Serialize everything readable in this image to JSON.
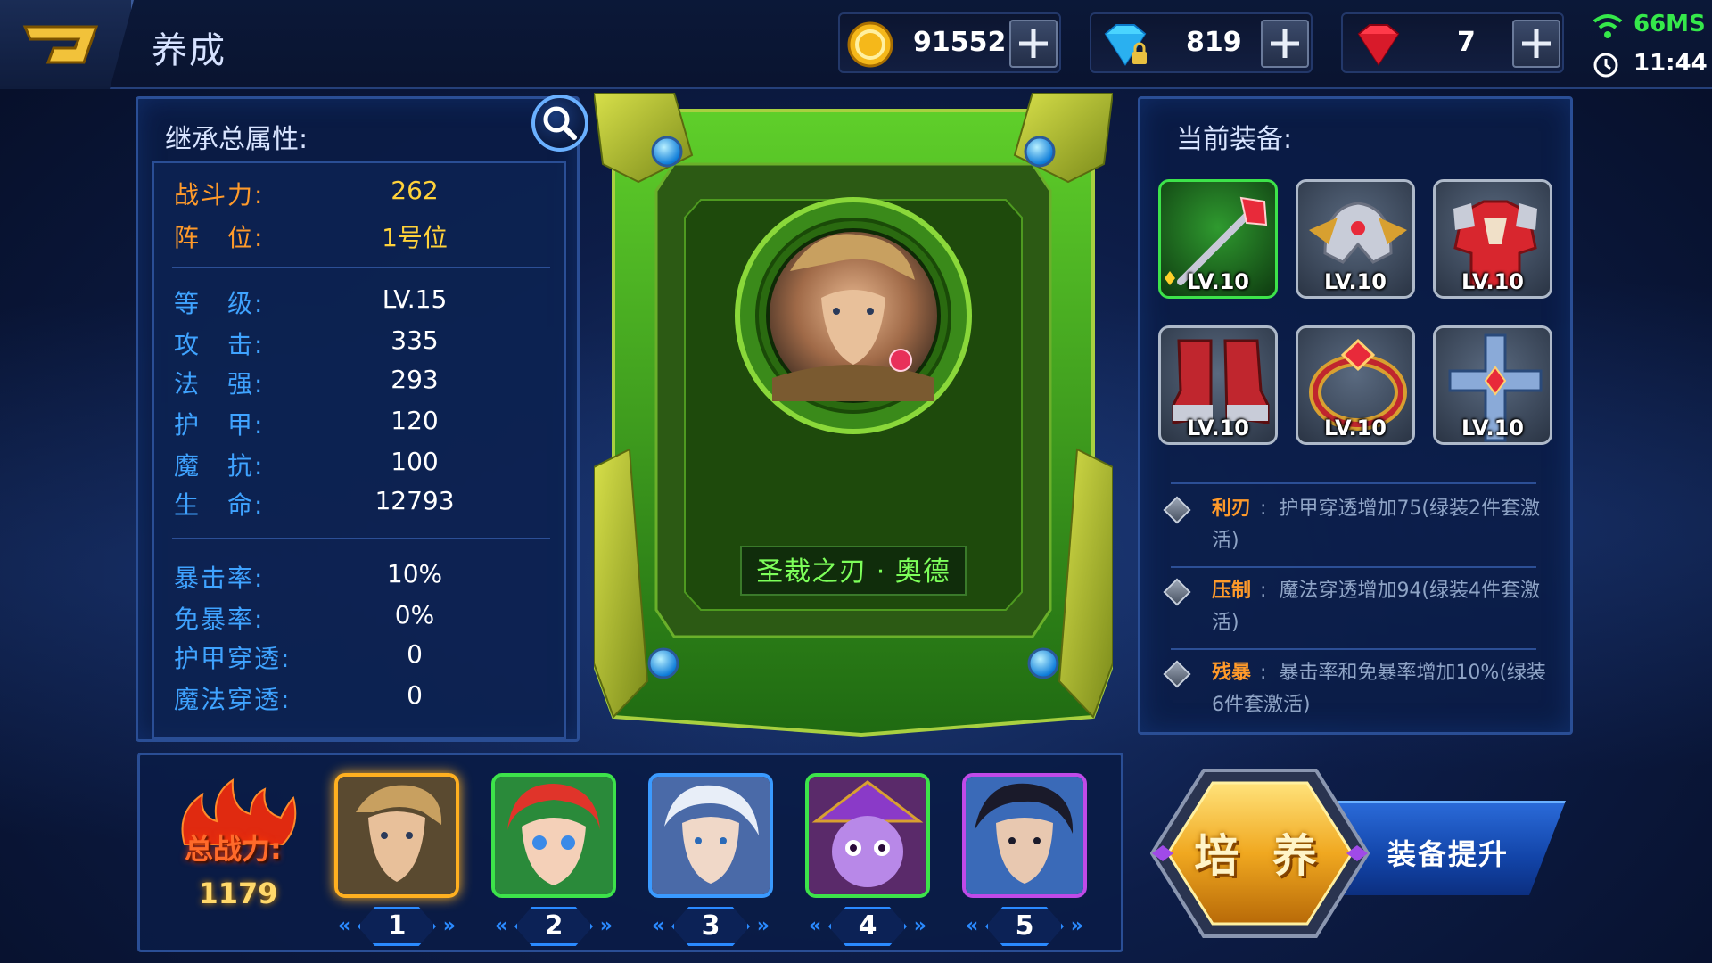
{
  "topbar": {
    "title": "养成",
    "gold": "91552",
    "diamonds": "819",
    "gems": "7",
    "ping": "66MS",
    "time": "11:44"
  },
  "stats_panel": {
    "title": "继承总属性:",
    "highlight": [
      {
        "label": "战斗力:",
        "value": "262"
      },
      {
        "label": "阵　位:",
        "value": "1号位"
      }
    ],
    "basic": [
      {
        "label": "等　级:",
        "value": "LV.15"
      },
      {
        "label": "攻　击:",
        "value": "335"
      },
      {
        "label": "法　强:",
        "value": "293"
      },
      {
        "label": "护　甲:",
        "value": "120"
      },
      {
        "label": "魔　抗:",
        "value": "100"
      },
      {
        "label": "生　命:",
        "value": "12793"
      }
    ],
    "advanced": [
      {
        "label": "暴击率:",
        "value": "10%"
      },
      {
        "label": "免暴率:",
        "value": "0%"
      },
      {
        "label": "护甲穿透:",
        "value": "0"
      },
      {
        "label": "魔法穿透:",
        "value": "0"
      }
    ]
  },
  "hero": {
    "name": "圣裁之刃 · 奥德"
  },
  "equipment": {
    "title": "当前装备:",
    "slots": [
      {
        "icon": "staff-icon",
        "level": "LV.10"
      },
      {
        "icon": "helmet-icon",
        "level": "LV.10"
      },
      {
        "icon": "armor-icon",
        "level": "LV.10"
      },
      {
        "icon": "boots-icon",
        "level": "LV.10"
      },
      {
        "icon": "ring-icon",
        "level": "LV.10"
      },
      {
        "icon": "cross-icon",
        "level": "LV.10"
      }
    ],
    "sets": [
      {
        "name": "利刃",
        "sep": ":",
        "desc": "护甲穿透增加75(绿装2件套激活)"
      },
      {
        "name": "压制",
        "sep": ":",
        "desc": "魔法穿透增加94(绿装4件套激活)"
      },
      {
        "name": "残暴",
        "sep": ":",
        "desc": "暴击率和免暴率增加10%(绿装6件套激活)"
      }
    ]
  },
  "team": {
    "total_label": "总战力:",
    "total_value": "1179",
    "members": [
      {
        "num": "1"
      },
      {
        "num": "2"
      },
      {
        "num": "3"
      },
      {
        "num": "4"
      },
      {
        "num": "5"
      }
    ]
  },
  "actions": {
    "train": "培 养",
    "upgrade": "装备提升"
  },
  "colors": {
    "accent_green": "#3de34a",
    "accent_orange": "#ff9a2a",
    "stat_blue": "#3fa3ff",
    "gold_text": "#ffd23a"
  }
}
